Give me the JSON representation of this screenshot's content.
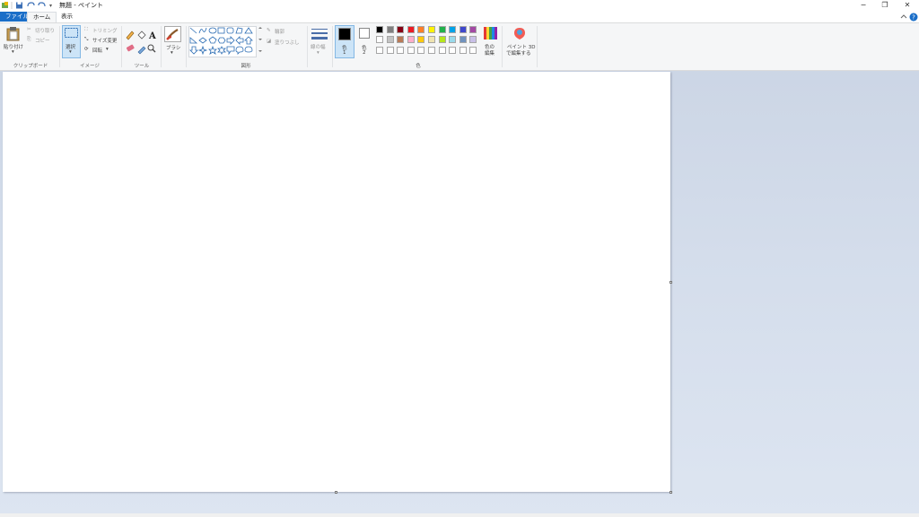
{
  "window": {
    "title": "無題 - ペイント",
    "minimize": "−",
    "restore": "❐",
    "close": "✕"
  },
  "tabs": {
    "file": "ファイル",
    "home": "ホーム",
    "view": "表示"
  },
  "clipboard": {
    "paste": "貼り付け",
    "cut": "切り取り",
    "copy": "コピー",
    "group": "クリップボード"
  },
  "image": {
    "select": "選択",
    "crop": "トリミング",
    "resize": "サイズ変更",
    "rotate": "回転",
    "group": "イメージ"
  },
  "tools": {
    "group": "ツール"
  },
  "brush": {
    "label": "ブラシ"
  },
  "shapes": {
    "outline": "輪郭",
    "fill": "塗りつぶし",
    "group": "図形"
  },
  "size": {
    "label": "線の幅"
  },
  "colors": {
    "color1": "色",
    "color1_num": "1",
    "color2": "色",
    "color2_num": "2",
    "edit": "色の",
    "edit2": "編集",
    "group": "色",
    "row1": [
      "#000000",
      "#7f7f7f",
      "#880015",
      "#ed1c24",
      "#ff7f27",
      "#fff200",
      "#22b14c",
      "#00a2e8",
      "#3f48cc",
      "#a349a4"
    ],
    "row2": [
      "#ffffff",
      "#c3c3c3",
      "#b97a57",
      "#ffaec9",
      "#ffc90e",
      "#efe4b0",
      "#b5e61d",
      "#99d9ea",
      "#7092be",
      "#c8bfe7"
    ],
    "row3": [
      "#ffffff",
      "#ffffff",
      "#ffffff",
      "#ffffff",
      "#ffffff",
      "#ffffff",
      "#ffffff",
      "#ffffff",
      "#ffffff",
      "#ffffff"
    ]
  },
  "paint3d": {
    "line1": "ペイント 3D",
    "line2": "で編集する"
  }
}
